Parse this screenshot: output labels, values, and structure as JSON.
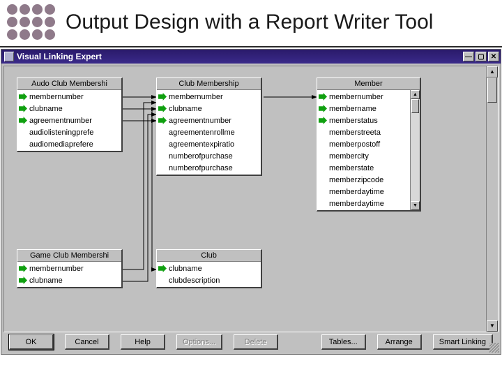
{
  "slide": {
    "title": "Output Design with a Report Writer Tool"
  },
  "window": {
    "title": "Visual Linking Expert",
    "min_glyph": "—",
    "max_glyph": "▢",
    "close_glyph": "✕"
  },
  "tables": {
    "audio": {
      "title": "Audo Club Membershi",
      "fields": [
        {
          "key": true,
          "label": "membernumber"
        },
        {
          "key": true,
          "label": "clubname"
        },
        {
          "key": true,
          "label": "agreementnumber"
        },
        {
          "key": false,
          "label": "audiolisteningprefe"
        },
        {
          "key": false,
          "label": "audiomediaprefere"
        }
      ]
    },
    "clubm": {
      "title": "Club Membership",
      "fields": [
        {
          "key": true,
          "label": "membernumber"
        },
        {
          "key": true,
          "label": "clubname"
        },
        {
          "key": true,
          "label": "agreementnumber"
        },
        {
          "key": false,
          "label": "agreementenrollme"
        },
        {
          "key": false,
          "label": "agreementexpiratio"
        },
        {
          "key": false,
          "label": "numberofpurchase"
        },
        {
          "key": false,
          "label": "numberofpurchase"
        }
      ]
    },
    "member": {
      "title": "Member",
      "fields": [
        {
          "key": true,
          "label": "membernumber"
        },
        {
          "key": true,
          "label": "membername"
        },
        {
          "key": true,
          "label": "memberstatus"
        },
        {
          "key": false,
          "label": "memberstreeta"
        },
        {
          "key": false,
          "label": "memberpostoff"
        },
        {
          "key": false,
          "label": "membercity"
        },
        {
          "key": false,
          "label": "memberstate"
        },
        {
          "key": false,
          "label": "memberzipcode"
        },
        {
          "key": false,
          "label": "memberdaytime"
        },
        {
          "key": false,
          "label": "memberdaytime"
        }
      ]
    },
    "game": {
      "title": "Game Club Membershi",
      "fields": [
        {
          "key": true,
          "label": "membernumber"
        },
        {
          "key": true,
          "label": "clubname"
        }
      ]
    },
    "club": {
      "title": "Club",
      "fields": [
        {
          "key": true,
          "label": "clubname"
        },
        {
          "key": false,
          "label": "clubdescription"
        }
      ]
    }
  },
  "buttons": {
    "ok": "OK",
    "cancel": "Cancel",
    "help": "Help",
    "options": "Options...",
    "delete": "Delete",
    "tables": "Tables...",
    "arrange": "Arrange",
    "smartlink": "Smart Linking"
  }
}
